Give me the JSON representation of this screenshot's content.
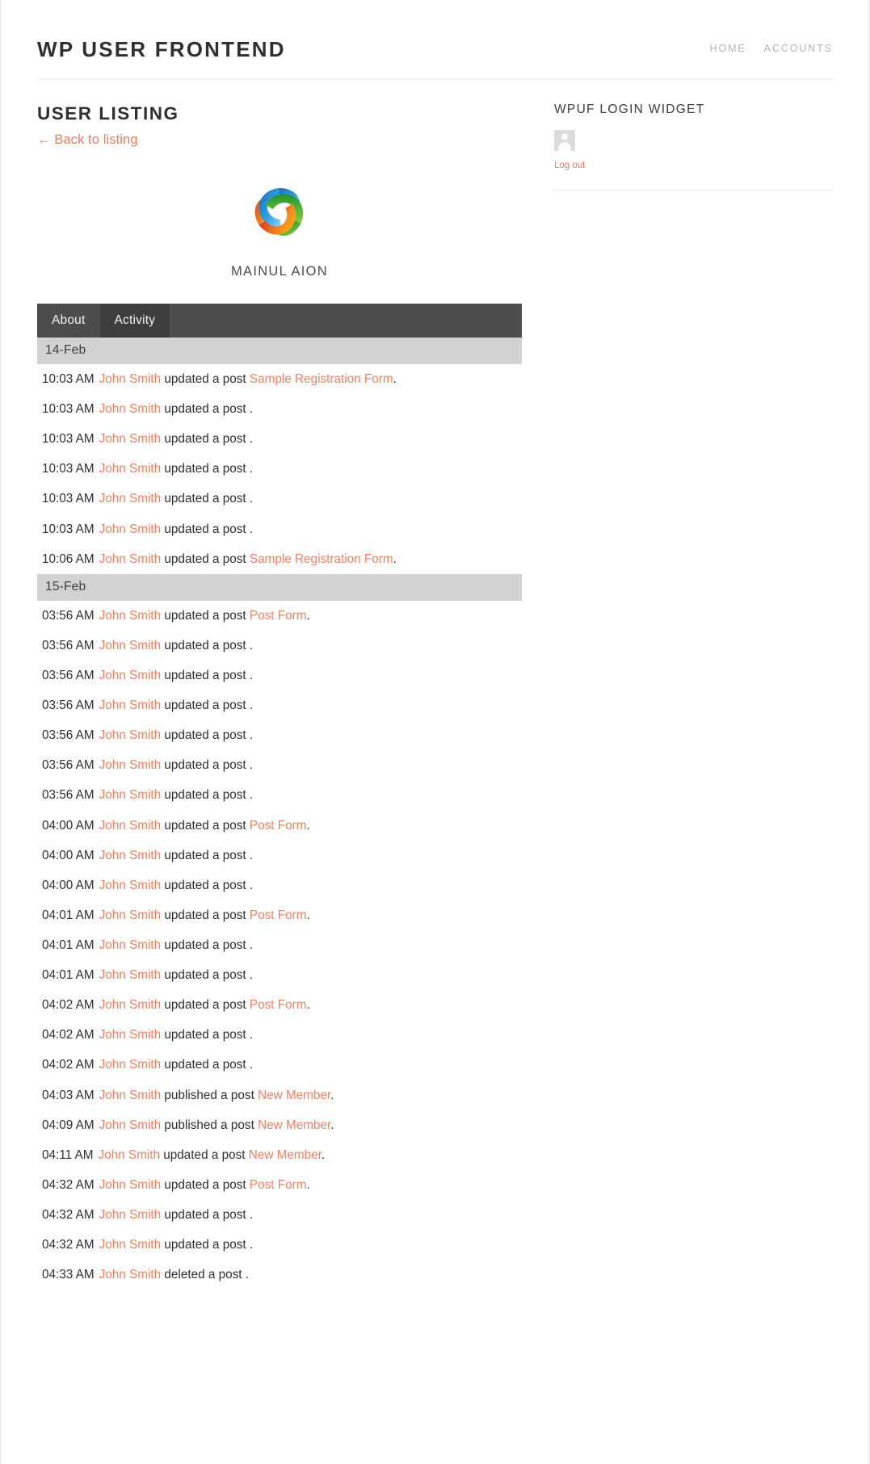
{
  "header": {
    "site_title": "WP User Frontend",
    "nav": [
      {
        "label": "Home",
        "name": "nav-home"
      },
      {
        "label": "Accounts",
        "name": "nav-accounts"
      }
    ]
  },
  "main": {
    "page_title": "User Listing",
    "back_link": "← Back to listing",
    "profile": {
      "name": "Mainul Aion",
      "avatar_alt": "profile-logo"
    },
    "tabs": [
      {
        "label": "About",
        "active": false
      },
      {
        "label": "Activity",
        "active": true
      }
    ]
  },
  "sidebar": {
    "widget_title": "WPUF Login Widget",
    "logout_label": "Log out"
  },
  "colors": {
    "accent": "#ef8162",
    "link": "#ee7a5c",
    "tab_bar": "#4d4d4d",
    "tab_active": "#3e3e3e",
    "date_header": "#d2d2d2",
    "nav_text": "#b9b2b0"
  },
  "activity": [
    {
      "date": "14-Feb",
      "items": [
        {
          "time": "10:03 AM",
          "user": "John Smith",
          "action": "updated a post",
          "post": "Sample Registration Form",
          "suffix": "."
        },
        {
          "time": "10:03 AM",
          "user": "John Smith",
          "action": "updated a post",
          "post": "",
          "suffix": "."
        },
        {
          "time": "10:03 AM",
          "user": "John Smith",
          "action": "updated a post",
          "post": "",
          "suffix": "."
        },
        {
          "time": "10:03 AM",
          "user": "John Smith",
          "action": "updated a post",
          "post": "",
          "suffix": "."
        },
        {
          "time": "10:03 AM",
          "user": "John Smith",
          "action": "updated a post",
          "post": "",
          "suffix": "."
        },
        {
          "time": "10:03 AM",
          "user": "John Smith",
          "action": "updated a post",
          "post": "",
          "suffix": "."
        },
        {
          "time": "10:06 AM",
          "user": "John Smith",
          "action": "updated a post",
          "post": "Sample Registration Form",
          "suffix": "."
        }
      ]
    },
    {
      "date": "15-Feb",
      "items": [
        {
          "time": "03:56 AM",
          "user": "John Smith",
          "action": "updated a post",
          "post": "Post Form",
          "suffix": "."
        },
        {
          "time": "03:56 AM",
          "user": "John Smith",
          "action": "updated a post",
          "post": "",
          "suffix": "."
        },
        {
          "time": "03:56 AM",
          "user": "John Smith",
          "action": "updated a post",
          "post": "",
          "suffix": "."
        },
        {
          "time": "03:56 AM",
          "user": "John Smith",
          "action": "updated a post",
          "post": "",
          "suffix": "."
        },
        {
          "time": "03:56 AM",
          "user": "John Smith",
          "action": "updated a post",
          "post": "",
          "suffix": "."
        },
        {
          "time": "03:56 AM",
          "user": "John Smith",
          "action": "updated a post",
          "post": "",
          "suffix": "."
        },
        {
          "time": "03:56 AM",
          "user": "John Smith",
          "action": "updated a post",
          "post": "",
          "suffix": "."
        },
        {
          "time": "04:00 AM",
          "user": "John Smith",
          "action": "updated a post",
          "post": "Post Form",
          "suffix": "."
        },
        {
          "time": "04:00 AM",
          "user": "John Smith",
          "action": "updated a post",
          "post": "",
          "suffix": "."
        },
        {
          "time": "04:00 AM",
          "user": "John Smith",
          "action": "updated a post",
          "post": "",
          "suffix": "."
        },
        {
          "time": "04:01 AM",
          "user": "John Smith",
          "action": "updated a post",
          "post": "Post Form",
          "suffix": "."
        },
        {
          "time": "04:01 AM",
          "user": "John Smith",
          "action": "updated a post",
          "post": "",
          "suffix": "."
        },
        {
          "time": "04:01 AM",
          "user": "John Smith",
          "action": "updated a post",
          "post": "",
          "suffix": "."
        },
        {
          "time": "04:02 AM",
          "user": "John Smith",
          "action": "updated a post",
          "post": "Post Form",
          "suffix": "."
        },
        {
          "time": "04:02 AM",
          "user": "John Smith",
          "action": "updated a post",
          "post": "",
          "suffix": "."
        },
        {
          "time": "04:02 AM",
          "user": "John Smith",
          "action": "updated a post",
          "post": "",
          "suffix": "."
        },
        {
          "time": "04:03 AM",
          "user": "John Smith",
          "action": "published a post",
          "post": "New Member",
          "suffix": "."
        },
        {
          "time": "04:09 AM",
          "user": "John Smith",
          "action": "published a post",
          "post": "New Member",
          "suffix": "."
        },
        {
          "time": "04:11 AM",
          "user": "John Smith",
          "action": "updated a post",
          "post": "New Member",
          "suffix": "."
        },
        {
          "time": "04:32 AM",
          "user": "John Smith",
          "action": "updated a post",
          "post": "Post Form",
          "suffix": "."
        },
        {
          "time": "04:32 AM",
          "user": "John Smith",
          "action": "updated a post",
          "post": "",
          "suffix": "."
        },
        {
          "time": "04:32 AM",
          "user": "John Smith",
          "action": "updated a post",
          "post": "",
          "suffix": "."
        },
        {
          "time": "04:33 AM",
          "user": "John Smith",
          "action": "deleted a post",
          "post": "",
          "suffix": "."
        }
      ]
    }
  ]
}
